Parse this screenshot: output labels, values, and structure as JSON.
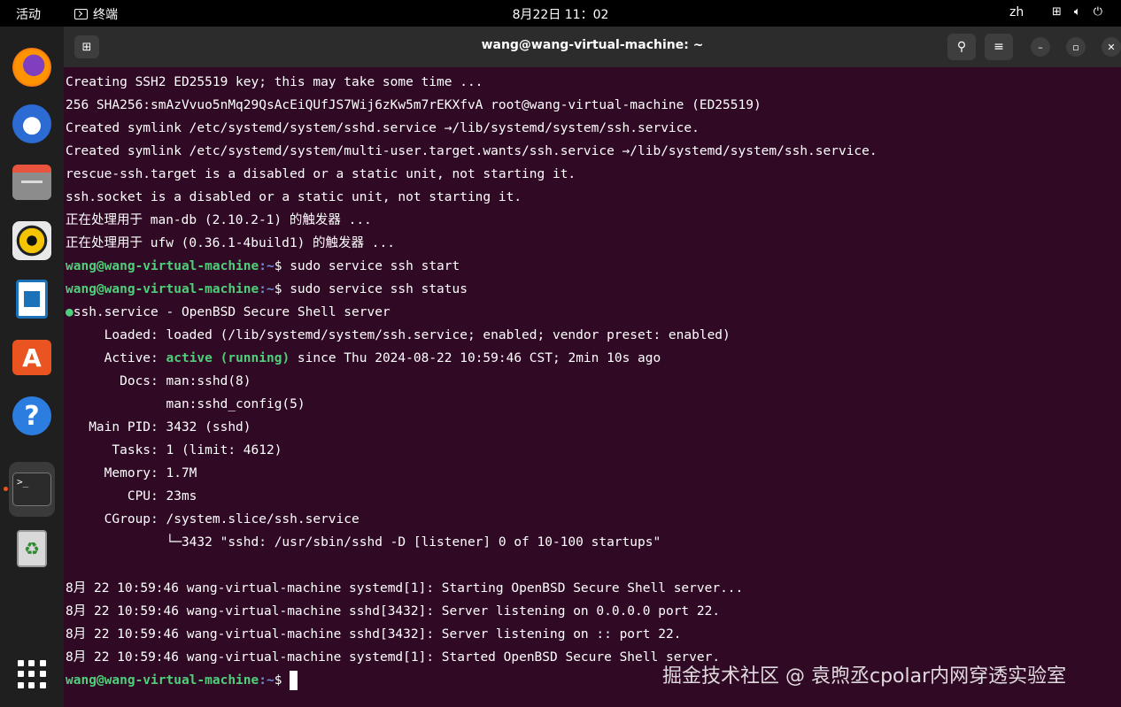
{
  "topbar": {
    "activities": "活动",
    "app_name": "终端",
    "clock": "8月22日  11：02",
    "lang": "zh",
    "icons": [
      "network-icon",
      "volume-icon",
      "power-icon"
    ]
  },
  "dock": {
    "items": [
      "firefox",
      "thunderbird",
      "files",
      "rhythmbox",
      "libreoffice-writer",
      "app-center",
      "help",
      "terminal",
      "trash"
    ],
    "active": "terminal"
  },
  "window": {
    "title": "wang@wang-virtual-machine: ~",
    "search_icon": "⚲",
    "menu_icon": "≡",
    "minimize": "–",
    "maximize": "▫",
    "close": "✕"
  },
  "terminal": {
    "prompt_user": "wang@wang-virtual-machine",
    "prompt_path": ":~",
    "prompt_symbol": "$ ",
    "lines": {
      "l1": "Creating SSH2 ED25519 key; this may take some time ...",
      "l2": "256 SHA256:smAzVvuo5nMq29QsAcEiQUfJS7Wij6zKw5m7rEKXfvA root@wang-virtual-machine (ED25519)",
      "l3": "Created symlink /etc/systemd/system/sshd.service →/lib/systemd/system/ssh.service.",
      "l4": "Created symlink /etc/systemd/system/multi-user.target.wants/ssh.service →/lib/systemd/system/ssh.service.",
      "l5": "rescue-ssh.target is a disabled or a static unit, not starting it.",
      "l6": "ssh.socket is a disabled or a static unit, not starting it.",
      "l7": "正在处理用于 man-db (2.10.2-1) 的触发器 ...",
      "l8": "正在处理用于 ufw (0.36.1-4build1) 的触发器 ...",
      "cmd1": "sudo service ssh start",
      "cmd2": "sudo service ssh status",
      "svc_bullet": "●",
      "svc_title": "ssh.service - OpenBSD Secure Shell server",
      "loaded": "     Loaded: loaded (/lib/systemd/system/ssh.service; enabled; vendor preset: enabled)",
      "active_label": "     Active: ",
      "active_state": "active (running)",
      "active_rest": " since Thu 2024-08-22 10:59:46 CST; 2min 10s ago",
      "docs1": "       Docs: man:sshd(8)",
      "docs2": "             man:sshd_config(5)",
      "mainpid": "   Main PID: 3432 (sshd)",
      "tasks": "      Tasks: 1 (limit: 4612)",
      "memory": "     Memory: 1.7M",
      "cpu": "        CPU: 23ms",
      "cgroup": "     CGroup: /system.slice/ssh.service",
      "cgroup_child": "             └─3432 \"sshd: /usr/sbin/sshd -D [listener] 0 of 10-100 startups\"",
      "log1": "8月 22 10:59:46 wang-virtual-machine systemd[1]: Starting OpenBSD Secure Shell server...",
      "log2": "8月 22 10:59:46 wang-virtual-machine sshd[3432]: Server listening on 0.0.0.0 port 22.",
      "log3": "8月 22 10:59:46 wang-virtual-machine sshd[3432]: Server listening on :: port 22.",
      "log4": "8月 22 10:59:46 wang-virtual-machine systemd[1]: Started OpenBSD Secure Shell server."
    }
  },
  "watermark": "掘金技术社区 @ 袁煦丞cpolar内网穿透实验室"
}
